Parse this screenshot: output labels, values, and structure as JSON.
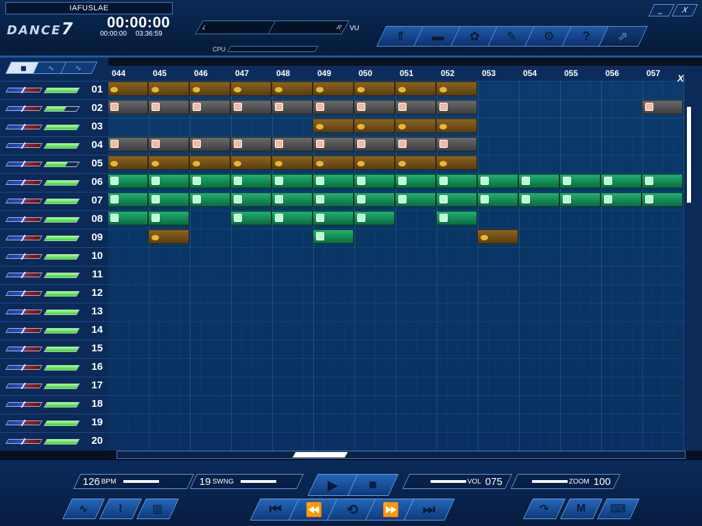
{
  "song_title": "IAFUSLAE",
  "app_logo": "DANCE",
  "app_logo_number": "7",
  "clock": {
    "main": "00:00:00",
    "elapsed": "00:00:00",
    "total": "03:36:59"
  },
  "meters": {
    "left": "L",
    "right": "R",
    "vu": "VU",
    "cpu": "CPU"
  },
  "toolbar": {
    "icons": [
      "sort-icon",
      "folder-icon",
      "mixer-icon",
      "edit-icon",
      "settings-icon",
      "help-icon",
      "export-icon"
    ],
    "glyphs": [
      "⇑",
      "▬",
      "✿",
      "✎",
      "⚙",
      "?",
      "⇗"
    ]
  },
  "window": {
    "minimize": "_",
    "close": "X"
  },
  "mode_tabs": [
    "◼",
    "∿",
    "∿"
  ],
  "ruler": [
    "044",
    "045",
    "046",
    "047",
    "048",
    "049",
    "050",
    "051",
    "052",
    "053",
    "054",
    "055",
    "056",
    "057"
  ],
  "tracks": [
    {
      "num": "01",
      "vol": 1.0
    },
    {
      "num": "02",
      "vol": 0.6
    },
    {
      "num": "03",
      "vol": 1.0
    },
    {
      "num": "04",
      "vol": 1.0
    },
    {
      "num": "05",
      "vol": 0.65
    },
    {
      "num": "06",
      "vol": 1.0
    },
    {
      "num": "07",
      "vol": 1.0
    },
    {
      "num": "08",
      "vol": 1.0
    },
    {
      "num": "09",
      "vol": 1.0
    },
    {
      "num": "10",
      "vol": 1.0
    },
    {
      "num": "11",
      "vol": 1.0
    },
    {
      "num": "12",
      "vol": 1.0
    },
    {
      "num": "13",
      "vol": 1.0
    },
    {
      "num": "14",
      "vol": 1.0
    },
    {
      "num": "15",
      "vol": 1.0
    },
    {
      "num": "16",
      "vol": 1.0
    },
    {
      "num": "17",
      "vol": 1.0
    },
    {
      "num": "18",
      "vol": 1.0
    },
    {
      "num": "19",
      "vol": 1.0
    },
    {
      "num": "20",
      "vol": 1.0
    }
  ],
  "clips": [
    {
      "track": 1,
      "type": "bass",
      "bars": [
        44,
        45,
        46,
        47,
        48,
        49,
        50,
        51,
        52
      ]
    },
    {
      "track": 2,
      "type": "drum",
      "bars": [
        44,
        45,
        46,
        47,
        48,
        49,
        50,
        51,
        52,
        57
      ]
    },
    {
      "track": 3,
      "type": "bass",
      "bars": [
        49,
        50,
        51,
        52
      ]
    },
    {
      "track": 4,
      "type": "drum",
      "bars": [
        44,
        45,
        46,
        47,
        48,
        49,
        50,
        51,
        52
      ]
    },
    {
      "track": 5,
      "type": "bass",
      "bars": [
        44,
        45,
        46,
        47,
        48,
        49,
        50,
        51,
        52
      ]
    },
    {
      "track": 6,
      "type": "lead",
      "bars": [
        44,
        45,
        46,
        47,
        48,
        49,
        50,
        51,
        52,
        53,
        54,
        55,
        56,
        57
      ]
    },
    {
      "track": 7,
      "type": "lead",
      "bars": [
        44,
        45,
        46,
        47,
        48,
        49,
        50,
        51,
        52,
        53,
        54,
        55,
        56,
        57
      ]
    },
    {
      "track": 8,
      "type": "lead",
      "bars": [
        44,
        45,
        47,
        48,
        49,
        50,
        52
      ]
    },
    {
      "track": 9,
      "type": "bass",
      "bars": [
        45,
        53
      ]
    },
    {
      "track": 9,
      "type": "lead",
      "bars": [
        49
      ]
    }
  ],
  "transport": {
    "bpm": "126",
    "bpm_label": "BPM",
    "swing": "19",
    "swing_label": "SWNG",
    "vol_label": "VOL",
    "vol": "075",
    "zoom_label": "ZOOM",
    "zoom": "100",
    "play": "▶",
    "stop": "■",
    "to_start": "⏮",
    "rewind": "⏪",
    "loop": "⟲",
    "forward": "⏩",
    "to_end": "⏭"
  },
  "bottom_left_icons": [
    "wave-icon",
    "envelope-icon",
    "pattern-icon"
  ],
  "bottom_left_glyphs": [
    "∿",
    "⌇",
    "▥"
  ],
  "bottom_right_icons": [
    "undo-icon",
    "midi-icon",
    "keyboard-icon"
  ],
  "bottom_right_glyphs": [
    "↷",
    "M",
    "⌨"
  ]
}
